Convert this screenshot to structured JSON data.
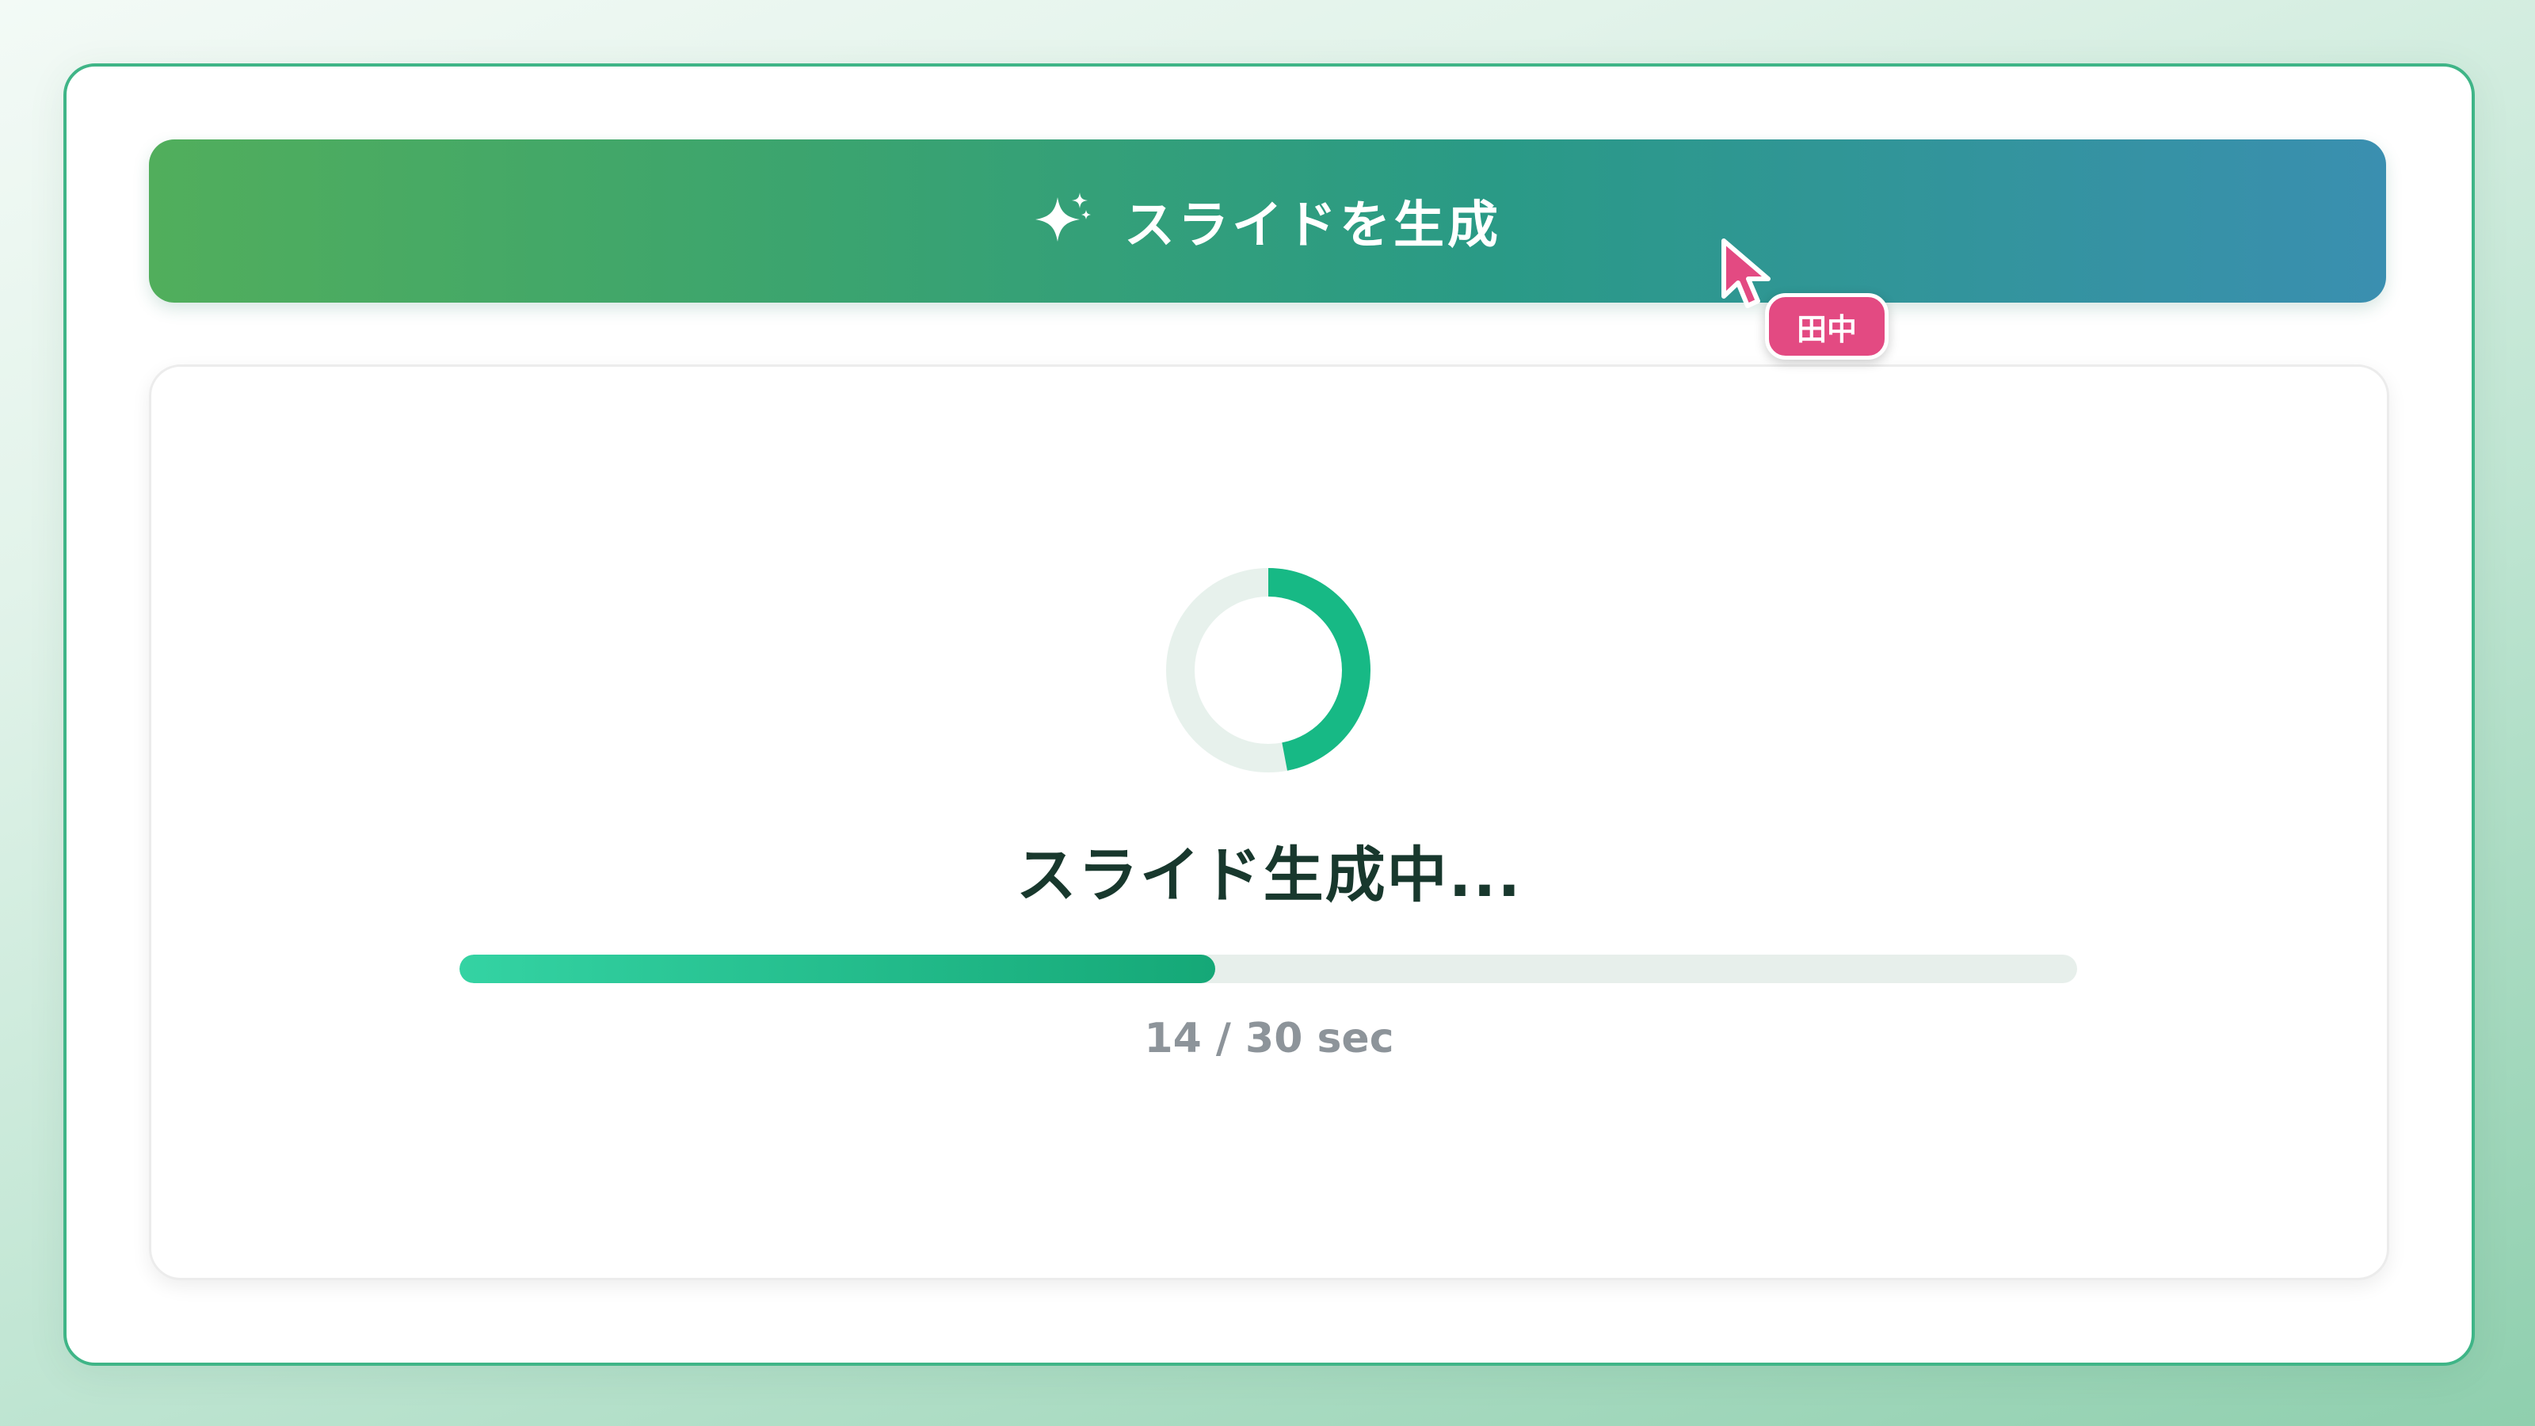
{
  "generate_button": {
    "icon": "sparkles-icon",
    "label": "スライドを生成",
    "gradient": [
      "#51ae5c",
      "#3a8fb0"
    ]
  },
  "progress_card": {
    "spinner_icon": "loading-ring-icon",
    "spinner_progress": 0.47,
    "status": "スライド生成中...",
    "elapsed_sec": 14,
    "total_sec": 30,
    "progress_fraction": 0.467,
    "timer_text": "14 / 30 sec",
    "accent_color": "#17b985",
    "track_color": "#e7f1ec"
  },
  "collaborator_cursor": {
    "icon": "pointer-cursor-icon",
    "name": "田中",
    "color": "#e34a82"
  }
}
